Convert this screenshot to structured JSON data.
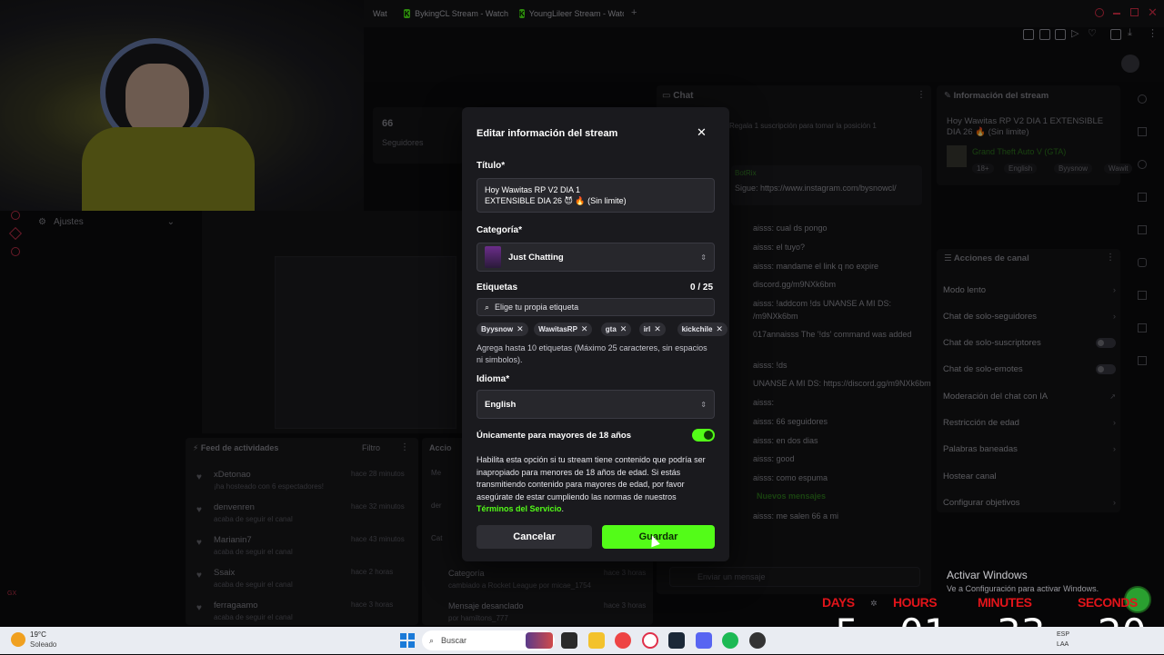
{
  "browser": {
    "tabs": [
      {
        "label": "Wat"
      },
      {
        "label": "BykingCL Stream - Watch"
      },
      {
        "label": "YoungLileer Stream - Watc"
      }
    ],
    "new_tab": "+"
  },
  "dashboard": {
    "followers": {
      "count": "66",
      "label": "Seguidores"
    },
    "settings_label": "Ajustes",
    "activity": {
      "title": "Feed de actividades",
      "filter_label": "Filtro",
      "items": [
        {
          "name": "xDetonao",
          "desc": "¡ha hosteado con 6 espectadores!",
          "time": "hace 28 minutos"
        },
        {
          "name": "denvenren",
          "desc": "acaba de seguir el canal",
          "time": "hace 32 minutos"
        },
        {
          "name": "Marianin7",
          "desc": "acaba de seguir el canal",
          "time": "hace 43 minutos"
        },
        {
          "name": "Ssaix",
          "desc": "acaba de seguir el canal",
          "time": "hace 2 horas"
        },
        {
          "name": "ferragaamo",
          "desc": "acaba de seguir el canal",
          "time": "hace 3 horas"
        }
      ]
    },
    "actions_title": "Accio",
    "actions": [
      {
        "label": "Categoría",
        "desc": "cambiado a Rocket League por micae_1754",
        "time": "hace 3 horas"
      },
      {
        "label": "Mensaje desanclado",
        "desc": "por hamiltons_777",
        "time": "hace 3 horas"
      }
    ]
  },
  "chat": {
    "title": "Chat",
    "gift_banner": "Regala 1 suscripción para tomar la posición 1",
    "pinned": {
      "user": "BotRix",
      "text": "Sigue: https://www.instagram.com/bysnowcl/"
    },
    "lines": [
      "aisss: cual ds pongo",
      "aisss: el tuyo?",
      "aisss: mandame el link q no expire",
      "discord.gg/m9NXk6bm",
      "aisss: !addcom !ds UNANSE A MI DS:",
      "/m9NXk6bm",
      "017annaisss The '!ds' command was added",
      "aisss: !ds",
      "UNANSE A MI DS: https://discord.gg/m9NXk6bm",
      "aisss:",
      "aisss: 66 seguidores",
      "aisss: en dos dias",
      "aisss: good",
      "aisss: como espuma"
    ],
    "new_messages": "Nuevos mensajes",
    "last_line": "aisss: me salen 66 a mi",
    "input_placeholder": "Enviar un mensaje"
  },
  "stream_info": {
    "title": "Información del stream",
    "stream_title": "Hoy Wawitas RP V2 DIA 1 EXTENSIBLE DIA 26 🔥 (Sin limite)",
    "category": "Grand Theft Auto V (GTA)",
    "tags": [
      "18+",
      "English",
      "Byysnow",
      "Wawit"
    ]
  },
  "channel_actions": {
    "title": "Acciones de canal",
    "items": [
      {
        "label": "Modo lento",
        "type": "arrow"
      },
      {
        "label": "Chat de solo-seguidores",
        "type": "arrow"
      },
      {
        "label": "Chat de solo-suscriptores",
        "type": "toggle"
      },
      {
        "label": "Chat de solo-emotes",
        "type": "toggle"
      },
      {
        "label": "Moderación del chat con IA",
        "type": "ext"
      },
      {
        "label": "Restricción de edad",
        "type": "arrow"
      },
      {
        "label": "Palabras baneadas",
        "type": "arrow"
      },
      {
        "label": "Hostear canal",
        "type": "none"
      },
      {
        "label": "Configurar objetivos",
        "type": "arrow"
      }
    ]
  },
  "modal": {
    "heading": "Editar información del stream",
    "title_label": "Título*",
    "title_value": "Hoy  Wawitas RP V2 DIA 1\nEXTENSIBLE DIA 26 😈 🔥 (Sin limite)",
    "category_label": "Categoría*",
    "category_value": "Just Chatting",
    "tags_label": "Etiquetas",
    "tags_count": "0 / 25",
    "tags_placeholder": "Elige tu propia etiqueta",
    "tags": [
      "Byysnow",
      "WawitasRP",
      "gta",
      "irl",
      "kickchile"
    ],
    "tags_help": "Agrega hasta 10 etiquetas (Máximo 25 caracteres, sin espacios ni simbolos).",
    "language_label": "Idioma*",
    "language_value": "English",
    "adult_label": "Únicamente para mayores de 18 años",
    "adult_enabled": true,
    "adult_help": "Habilita esta opción si tu stream tiene contenido que podría ser inapropiado para menores de 18 años de edad. Si estás transmitiendo contenido para mayores de edad, por favor asegúrate de estar cumpliendo las normas de nuestros",
    "terms_link": "Términos del Servicio",
    "terms_end": ".",
    "cancel_label": "Cancelar",
    "save_label": "Guardar"
  },
  "windows_activation": {
    "title": "Activar Windows",
    "subtitle": "Ve a Configuración para activar Windows."
  },
  "countdown": {
    "labels": {
      "days": "DAYS",
      "hours": "HOURS",
      "minutes": "MINUTES",
      "seconds": "SECONDS"
    },
    "values": {
      "days": "5",
      "hours": "01",
      "minutes": "33",
      "seconds": "20"
    }
  },
  "taskbar": {
    "weather_temp": "19°C",
    "weather_desc": "Soleado",
    "search_placeholder": "Buscar",
    "lang": "ESP",
    "lang2": "LAA"
  },
  "colors": {
    "accent": "#53fc18",
    "countdown_label": "#e1141a",
    "modal_bg": "#1a1a1e"
  }
}
